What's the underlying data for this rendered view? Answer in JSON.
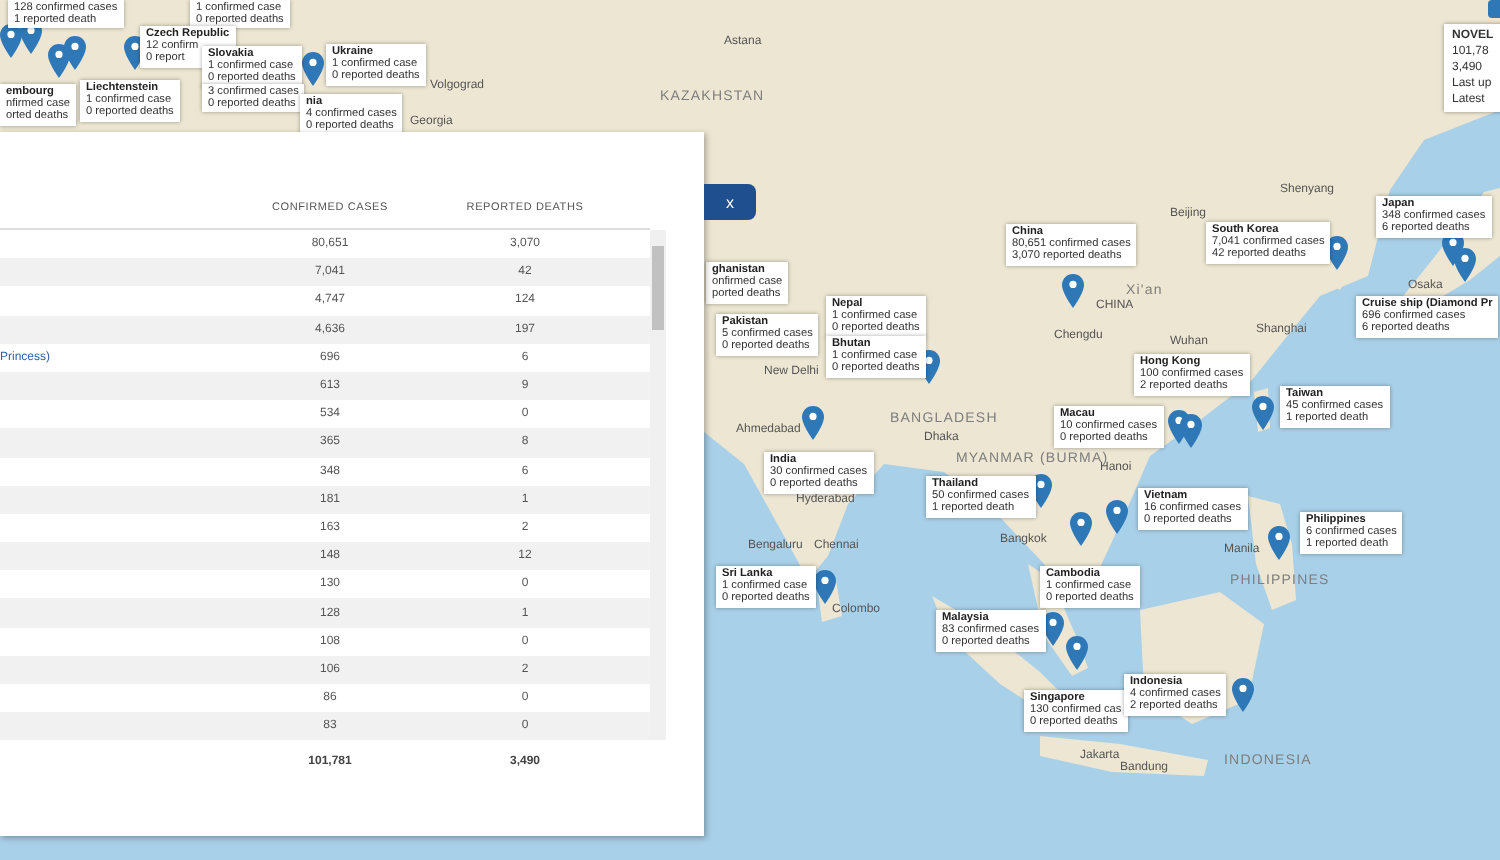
{
  "table": {
    "columns": [
      {
        "label": "CONFIRMED CASES"
      },
      {
        "label": "REPORTED DEATHS"
      }
    ],
    "rows": [
      {
        "cases": "80,651",
        "deaths": "3,070"
      },
      {
        "cases": "7,041",
        "deaths": "42"
      },
      {
        "cases": "4,747",
        "deaths": "124"
      },
      {
        "cases": "4,636",
        "deaths": "197"
      },
      {
        "name": "Princess)",
        "cases": "696",
        "deaths": "6"
      },
      {
        "cases": "613",
        "deaths": "9"
      },
      {
        "cases": "534",
        "deaths": "0"
      },
      {
        "cases": "365",
        "deaths": "8"
      },
      {
        "cases": "348",
        "deaths": "6"
      },
      {
        "cases": "181",
        "deaths": "1"
      },
      {
        "cases": "163",
        "deaths": "2"
      },
      {
        "cases": "148",
        "deaths": "12"
      },
      {
        "cases": "130",
        "deaths": "0"
      },
      {
        "cases": "128",
        "deaths": "1"
      },
      {
        "cases": "108",
        "deaths": "0"
      },
      {
        "cases": "106",
        "deaths": "2"
      },
      {
        "cases": "86",
        "deaths": "0"
      },
      {
        "cases": "83",
        "deaths": "0"
      }
    ],
    "total": {
      "cases": "101,781",
      "deaths": "3,490"
    }
  },
  "close_tab": "x",
  "summary": {
    "title": "NOVEL",
    "lines": [
      "101,78",
      "3,490",
      "Last up",
      "Latest"
    ]
  },
  "callouts": [
    {
      "lines": [
        "128 confirmed cases",
        "1 reported death"
      ]
    },
    {
      "lines": [
        "1 confirmed case",
        "0 reported deaths"
      ]
    },
    {
      "title": "Czech Republic",
      "lines": [
        "12 confirm",
        "0 report"
      ]
    },
    {
      "title": "Slovakia",
      "lines": [
        "1 confirmed case",
        "0 reported deaths"
      ]
    },
    {
      "title": "Ukraine",
      "lines": [
        "1 confirmed case",
        "0 reported deaths"
      ]
    },
    {
      "title": "embourg",
      "lines": [
        "nfirmed case",
        "orted deaths"
      ]
    },
    {
      "title": "Liechtenstein",
      "lines": [
        "1 confirmed case",
        "0 reported deaths"
      ]
    },
    {
      "lines": [
        "3 confirmed cases",
        "0 reported deaths"
      ]
    },
    {
      "title": "nia",
      "lines": [
        "4 confirmed cases",
        "0 reported deaths"
      ]
    },
    {
      "title": "ghanistan",
      "lines": [
        "onfirmed case",
        "ported deaths"
      ]
    },
    {
      "title": "China",
      "lines": [
        "80,651 confirmed cases",
        "3,070 reported deaths"
      ]
    },
    {
      "title": "South Korea",
      "lines": [
        "7,041 confirmed cases",
        "42 reported deaths"
      ]
    },
    {
      "title": "Japan",
      "lines": [
        "348 confirmed cases",
        "6 reported deaths"
      ]
    },
    {
      "title": "Pakistan",
      "lines": [
        "5 confirmed cases",
        "0 reported deaths"
      ]
    },
    {
      "title": "Nepal",
      "lines": [
        "1 confirmed case",
        "0 reported deaths"
      ]
    },
    {
      "title": "Cruise ship (Diamond Pr",
      "lines": [
        "696 confirmed cases",
        "6 reported deaths"
      ]
    },
    {
      "title": "Bhutan",
      "lines": [
        "1 confirmed case",
        "0 reported deaths"
      ]
    },
    {
      "title": "Hong Kong",
      "lines": [
        "100 confirmed cases",
        "2 reported deaths"
      ]
    },
    {
      "title": "Taiwan",
      "lines": [
        "45 confirmed cases",
        "1 reported death"
      ]
    },
    {
      "title": "Macau",
      "lines": [
        "10 confirmed cases",
        "0 reported deaths"
      ]
    },
    {
      "title": "India",
      "lines": [
        "30 confirmed cases",
        "0 reported deaths"
      ]
    },
    {
      "title": "Thailand",
      "lines": [
        "50 confirmed cases",
        "1 reported death"
      ]
    },
    {
      "title": "Vietnam",
      "lines": [
        "16 confirmed cases",
        "0 reported deaths"
      ]
    },
    {
      "title": "Philippines",
      "lines": [
        "6 confirmed cases",
        "1 reported death"
      ]
    },
    {
      "title": "Sri Lanka",
      "lines": [
        "1 confirmed case",
        "0 reported deaths"
      ]
    },
    {
      "title": "Cambodia",
      "lines": [
        "1 confirmed case",
        "0 reported deaths"
      ]
    },
    {
      "title": "Malaysia",
      "lines": [
        "83 confirmed cases",
        "0 reported deaths"
      ]
    },
    {
      "title": "Singapore",
      "lines": [
        "130 confirmed cas",
        "0 reported deaths"
      ]
    },
    {
      "title": "Indonesia",
      "lines": [
        "4 confirmed cases",
        "2 reported deaths"
      ]
    }
  ],
  "places": [
    {
      "label": "Astana"
    },
    {
      "label": "KAZAKHSTAN"
    },
    {
      "label": "Volgograd"
    },
    {
      "label": "Georgia"
    },
    {
      "label": "Beijing"
    },
    {
      "label": "Shenyang"
    },
    {
      "label": "Xi'an"
    },
    {
      "label": "CHINA"
    },
    {
      "label": "Chengdu"
    },
    {
      "label": "Wuhan"
    },
    {
      "label": "Shanghai"
    },
    {
      "label": "Osaka"
    },
    {
      "label": "New Delhi"
    },
    {
      "label": "Ahmedabad"
    },
    {
      "label": "BANGLADESH"
    },
    {
      "label": "Dhaka"
    },
    {
      "label": "MYANMAR (BURMA)"
    },
    {
      "label": "Hanoi"
    },
    {
      "label": "Hyderabad"
    },
    {
      "label": "Bengaluru"
    },
    {
      "label": "Chennai"
    },
    {
      "label": "Bangkok"
    },
    {
      "label": "Manila"
    },
    {
      "label": "PHILIPPINES"
    },
    {
      "label": "Colombo"
    },
    {
      "label": "Jakarta"
    },
    {
      "label": "Bandung"
    },
    {
      "label": "INDONESIA"
    }
  ]
}
